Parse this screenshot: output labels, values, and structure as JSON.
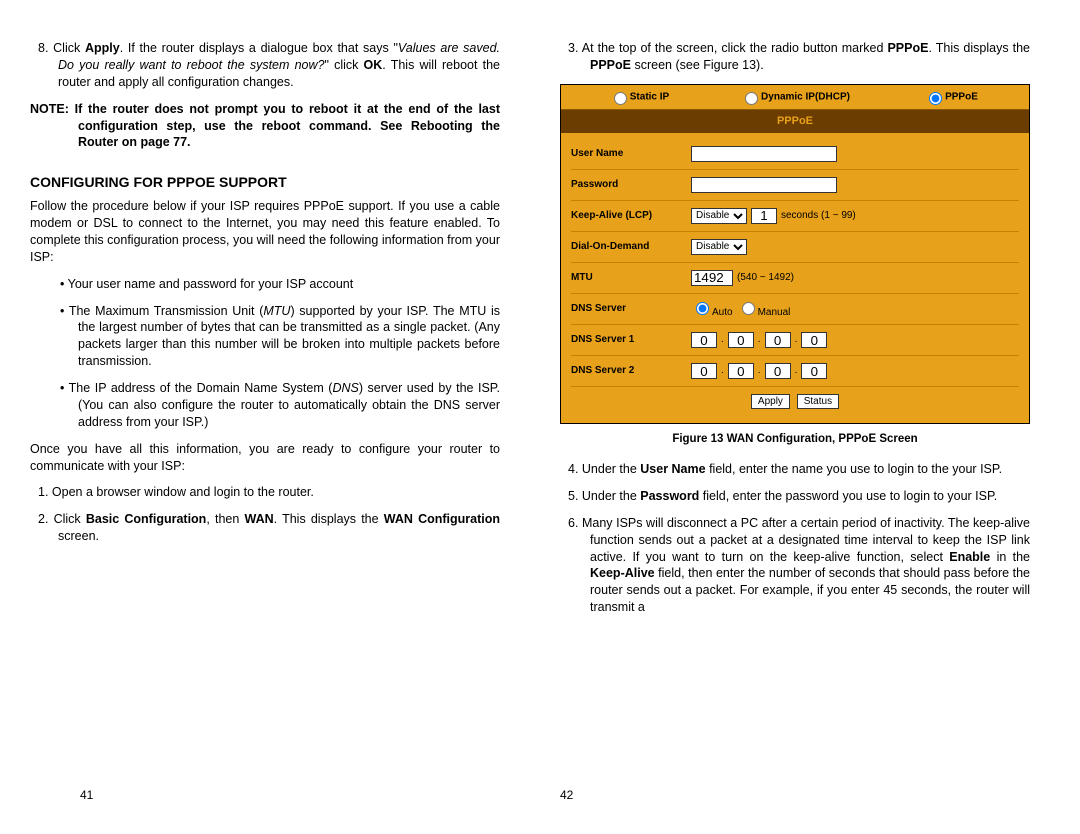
{
  "left": {
    "step8": "8.   Click <b>Apply</b>.  If the router displays a dialogue box that says \"<i>Values are saved. Do you really want to reboot the system now?</i>\" click <b>OK</b>.  This will reboot the router and apply all configuration changes.",
    "note": "NOTE:  If the router does not prompt you to reboot it at the end of the last configuration step, use the reboot command.   See Rebooting the Router on page 77.",
    "section": "CONFIGURING FOR PPPOE SUPPORT",
    "intro": "Follow the procedure below if your ISP requires PPPoE support.  If you use a cable modem or DSL to connect to the Internet, you may need this feature enabled.   To complete this configuration process, you will need the following information from your ISP:",
    "b1": "•    Your user name and password for your ISP account",
    "b2": "•    The Maximum Transmission Unit (<i>MTU</i>) supported by your ISP.   The MTU is the largest number of bytes that can be transmitted as a single packet.  (Any packets larger than this number will be broken into multiple packets before transmission.",
    "b3": "•    The IP address of the Domain Name System (<i>DNS</i>) server used by the ISP. (You can also configure the router to automatically obtain the DNS server address from your ISP.)",
    "once": "Once you have all this information, you are ready to configure your router to communicate with your ISP:",
    "s1": "1.   Open a browser window and login to the router.",
    "s2": "2.   Click <b>Basic Configuration</b>, then <b>WAN</b>. This displays the <b>WAN Configuration</b> screen.",
    "pagenum": "41"
  },
  "right": {
    "s3": "3.   At the top of the screen, click the radio button marked <b>PPPoE</b>.   This displays the <b>PPPoE</b> screen (see Figure 13).",
    "figcap": "Figure 13    WAN Configuration, PPPoE Screen",
    "s4": "4.   Under the <b>User Name</b> field, enter the name you use to login to the your ISP.",
    "s5": "5.   Under the <b>Password</b> field, enter the password you use to login to your ISP.",
    "s6": "6.   Many ISPs will disconnect a PC after a certain period of inactivity.  The keep-alive function sends out a packet at a designated time interval to keep the ISP link active.   If you want to turn on the keep-alive function, select <b>Enable</b> in the <b>Keep-Alive</b> field, then enter the number of seconds that should pass before the router sends out a packet. For example, if you enter 45 seconds, the router will transmit a",
    "pagenum": "42"
  },
  "shot": {
    "tab_static": "Static IP",
    "tab_dhcp": "Dynamic IP(DHCP)",
    "tab_pppoe": "PPPoE",
    "title": "PPPoE",
    "row_user": "User Name",
    "row_pass": "Password",
    "row_keep": "Keep-Alive (LCP)",
    "row_dial": "Dial-On-Demand",
    "row_mtu": "MTU",
    "row_dns": "DNS Server",
    "row_dns1": "DNS Server 1",
    "row_dns2": "DNS Server 2",
    "keep_sel": "Disable",
    "keep_val": "1",
    "keep_hint": "seconds (1 ~ 99)",
    "dial_sel": "Disable",
    "mtu_val": "1492",
    "mtu_hint": "(540 ~ 1492)",
    "dns_auto": "Auto",
    "dns_manual": "Manual",
    "oct": "0",
    "btn_apply": "Apply",
    "btn_status": "Status"
  }
}
